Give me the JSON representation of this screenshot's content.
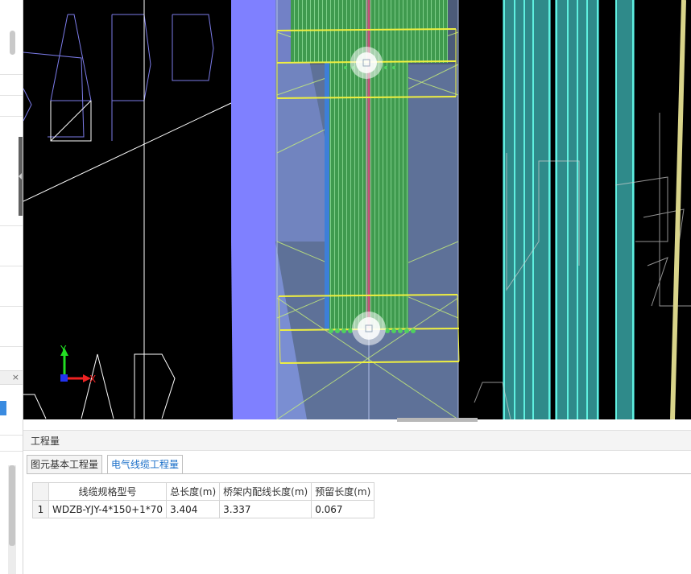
{
  "viewport": {
    "axis_y_label": "Y",
    "axis_x_label": "X"
  },
  "panel": {
    "title": "工程量",
    "tabs": [
      {
        "label": "图元基本工程量",
        "active": false
      },
      {
        "label": "电气线缆工程量",
        "active": true
      }
    ],
    "table": {
      "columns": [
        "线缆规格型号",
        "总长度(m)",
        "桥架内配线长度(m)",
        "预留长度(m)"
      ],
      "rows": [
        {
          "index": "1",
          "spec": "WDZB-YJY-4*150+1*70",
          "total": "3.404",
          "tray": "3.337",
          "reserve": "0.067"
        }
      ]
    }
  },
  "colors": {
    "cad_background": "#000000",
    "cable_tray_fill": "#7f80ff",
    "green_hatch": "#4fae5c",
    "yellow_line": "#f0f040",
    "cyan_lines": "#3fd1c5",
    "active_tab_text": "#1a6fc9"
  },
  "left_strip": {
    "close_glyph": "×"
  }
}
